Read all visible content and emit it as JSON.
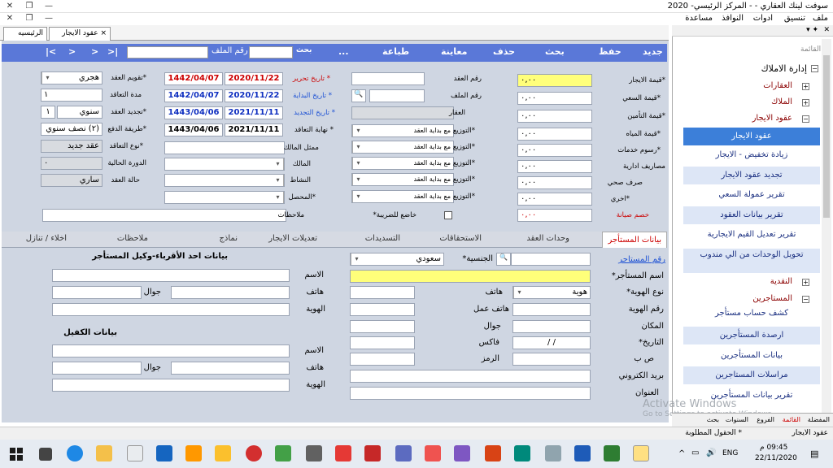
{
  "window": {
    "title": "سوفت لينك العقاري - - المركز الرئيسي- 2020",
    "minimize_icon": "minimize-icon",
    "maximize_icon": "maximize-icon",
    "close_icon": "close-icon"
  },
  "menu": [
    "ملف",
    "تنسيق",
    "ادوات",
    "النوافذ",
    "مساعدة"
  ],
  "tabs": {
    "home": "الرئيسيه",
    "contracts": "عقود الايجار",
    "close": "×"
  },
  "toolbar": {
    "new": "جديد",
    "save": "حفظ",
    "search": "بحث",
    "delete": "حذف",
    "preview": "معاينة",
    "print": "طباعة",
    "more": "...",
    "search2": "بحث",
    "file_no_label": "رقم الملف",
    "nav": [
      ">|",
      ">",
      ">",
      "|<"
    ],
    "search_value": "",
    "file_value": ""
  },
  "fields": {
    "rent_value": {
      "label": "*قيمة الايجار",
      "value": "٠,٠٠"
    },
    "commission_value": {
      "label": "*قيمة السعي",
      "value": "٠,٠٠"
    },
    "insurance_value": {
      "label": "*قيمة التأمين",
      "value": "٠,٠٠"
    },
    "water_value": {
      "label": "*قيمة المياه",
      "value": "٠,٠٠"
    },
    "service_fees": {
      "label": "*رسوم خدمات",
      "value": "٠,٠٠"
    },
    "admin_expenses": {
      "label": "مصاريف ادارية",
      "value": "٠,٠٠"
    },
    "sanitation": {
      "label": "صرف صحي",
      "value": "٠,٠٠"
    },
    "other": {
      "label": "*اخري",
      "value": "٠,٠٠"
    },
    "maintenance_discount": {
      "label": "خصم صيانة",
      "value": "٠,٠٠"
    },
    "contract_no": {
      "label": "رقم العقد",
      "value": ""
    },
    "file_no": {
      "label": "رقم الملف",
      "value": ""
    },
    "property": {
      "label": "العقار",
      "value": ""
    },
    "distribution_label": "*التوزيع",
    "distribution_value": "مع بداية العقد",
    "owner_rep": {
      "label": "ممثل المالك",
      "value": ""
    },
    "owner": {
      "label": "المالك",
      "value": ""
    },
    "activity": {
      "label": "النشاط",
      "value": ""
    },
    "collector": {
      "label": "*المحصل",
      "value": ""
    },
    "notes": {
      "label": "ملاحظات",
      "value": ""
    },
    "taxable": {
      "label": "خاضع للضريبة*"
    },
    "write_date": {
      "label": "* تاريخ تحرير",
      "g": "2020/11/22",
      "h": "1442/04/07"
    },
    "start_date": {
      "label": "* تاريخ البداية",
      "g": "2020/11/22",
      "h": "1442/04/07"
    },
    "renew_date": {
      "label": "* تاريخ التجديد",
      "g": "2021/11/11",
      "h": "1443/04/06"
    },
    "end_date": {
      "label": "* نهاية التعاقد",
      "g": "2021/11/11",
      "h": "1443/04/06"
    },
    "calendar": {
      "label": "*تقويم العقد",
      "value": "هجري"
    },
    "duration": {
      "label": "مدة التعاقد",
      "value": "١"
    },
    "renewal": {
      "label": "*تجديد العقد",
      "value": "سنوي",
      "count": "١"
    },
    "payment": {
      "label": "*طريقة الدفع",
      "value": "(٢) نصف سنوي"
    },
    "contract_type": {
      "label": "*نوع التعاقد",
      "value": "عقد جديد"
    },
    "current_cycle": {
      "label": "الدورة الحالية",
      "value": "٠"
    },
    "contract_status": {
      "label": "حالة العقد",
      "value": "ساري"
    }
  },
  "inner_tabs": [
    "بيانات المستأجر",
    "وحدات العقد",
    "الاستحقاقات",
    "التسديدات",
    "تعديلات الايجار",
    "نماذج",
    "ملاحظات",
    "اخلاء / تنازل"
  ],
  "tenant": {
    "file_link": "رقم المستاجر",
    "nationality_label": "الجنسية*",
    "nationality_value": "سعودي",
    "name_label": "اسم المستأجر*",
    "id_type_label": "نوع الهوية*",
    "id_type_value": "هوية",
    "phone_label": "هاتف",
    "id_no_label": "رقم الهوية",
    "work_phone_label": "هاتف عمل",
    "place_label": "المكان",
    "mobile_label": "جوال",
    "date_label": "التاريخ*",
    "date_value": "/ /",
    "fax_label": "فاكس",
    "pobox_label": "ص ب",
    "zip_label": "الرمز",
    "email_label": "بريد الكتروني",
    "address_label": "العنوان"
  },
  "relative": {
    "title": "بيانات احد الأقرباء-وكيل المستأجر",
    "name_label": "الاسم",
    "phone_label": "هاتف",
    "mobile_label": "جوال",
    "id_label": "الهوية"
  },
  "guarantor": {
    "title": "بيانات الكفيل",
    "name_label": "الاسم",
    "phone_label": "هاتف",
    "mobile_label": "جوال",
    "id_label": "الهوية"
  },
  "panel": {
    "header": "القائمة",
    "root": "إدارة الاملاك",
    "nodes": [
      "العقارات",
      "الملاك",
      "عقود الايجار"
    ],
    "items": [
      "عقود الايجار",
      "زيادة تخفيض - الايجار",
      "تجديد عقود الايجار",
      "تقرير عمولة السعي",
      "تقرير بيانات العقود",
      "تقرير تعديل القيم الايجارية",
      "تحويل الوحدات من الي مندوب"
    ],
    "nodes2": [
      "النقدية",
      "المستاجرين"
    ],
    "items2": [
      "كشف حساب مستأجر",
      "ارصدة المستأجرين",
      "بيانات المستأجرين",
      "مراسلات المستاجرين",
      "تقرير بيانات المستأجرين"
    ],
    "bottom_tabs": [
      "المفضلة",
      "القائمة",
      "الفروع",
      "السنوات",
      "بحث"
    ]
  },
  "status": {
    "left": "عقود الايجار",
    "right": "* الحقول المطلوبة"
  },
  "watermark": {
    "line1": "Activate Windows",
    "line2": "Go to Settings to activate Windows."
  },
  "taskbar": {
    "time": "09:45 م",
    "date": "22/11/2020",
    "lang": "ENG"
  }
}
